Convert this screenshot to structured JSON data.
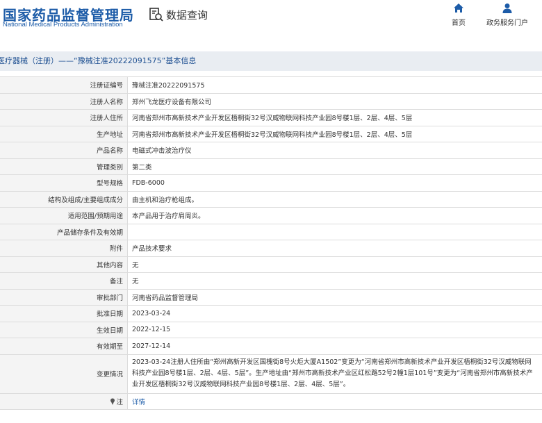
{
  "header": {
    "logo_cn": "国家药品监督管理局",
    "logo_en": "National Medical Products Administration",
    "query_label": "数据查询",
    "nav": [
      {
        "label": "首页",
        "icon": "home-icon"
      },
      {
        "label": "政务服务门户",
        "icon": "user-icon"
      }
    ],
    "brand_color": "#1d5ca8"
  },
  "title_bar": {
    "text": "医疗器械（注册）——“豫械注准20222091575”基本信息"
  },
  "rows": [
    {
      "label": "注册证编号",
      "value": "豫械注准20222091575"
    },
    {
      "label": "注册人名称",
      "value": "郑州飞龙医疗设备有限公司"
    },
    {
      "label": "注册人住所",
      "value": "河南省郑州市高新技术产业开发区梧桐街32号汉威物联网科技产业园8号楼1层、2层、4层、5层"
    },
    {
      "label": "生产地址",
      "value": "河南省郑州市高新技术产业开发区梧桐街32号汉威物联网科技产业园8号楼1层、2层、4层、5层"
    },
    {
      "label": "产品名称",
      "value": "电磁式冲击波治疗仪"
    },
    {
      "label": "管理类别",
      "value": "第二类"
    },
    {
      "label": "型号规格",
      "value": "FDB-6000"
    },
    {
      "label": "结构及组成/主要组成成分",
      "value": "由主机和治疗枪组成。"
    },
    {
      "label": "适用范围/预期用途",
      "value": "本产品用于治疗肩周炎。"
    },
    {
      "label": "产品储存条件及有效期",
      "value": ""
    },
    {
      "label": "附件",
      "value": "产品技术要求"
    },
    {
      "label": "其他内容",
      "value": "无"
    },
    {
      "label": "备注",
      "value": "无"
    },
    {
      "label": "审批部门",
      "value": "河南省药品监督管理局"
    },
    {
      "label": "批准日期",
      "value": "2023-03-24"
    },
    {
      "label": "生效日期",
      "value": "2022-12-15"
    },
    {
      "label": "有效期至",
      "value": "2027-12-14"
    }
  ],
  "change_row": {
    "label": "变更情况",
    "value": "2023-03-24注册人住所由“郑州高新开发区国槐街8号火炬大厦A1502”变更为“河南省郑州市高新技术产业开发区梧桐街32号汉威物联网科技产业园8号楼1层、2层、4层、5层”。生产地址由“郑州市高新技术产业区红松路52号2幢1层101号”变更为“河南省郑州市高新技术产业开发区梧桐街32号汉威物联网科技产业园8号楼1层、2层、4层、5层”。"
  },
  "note_row": {
    "label": "注",
    "icon": "pin-icon",
    "link": "详情"
  }
}
